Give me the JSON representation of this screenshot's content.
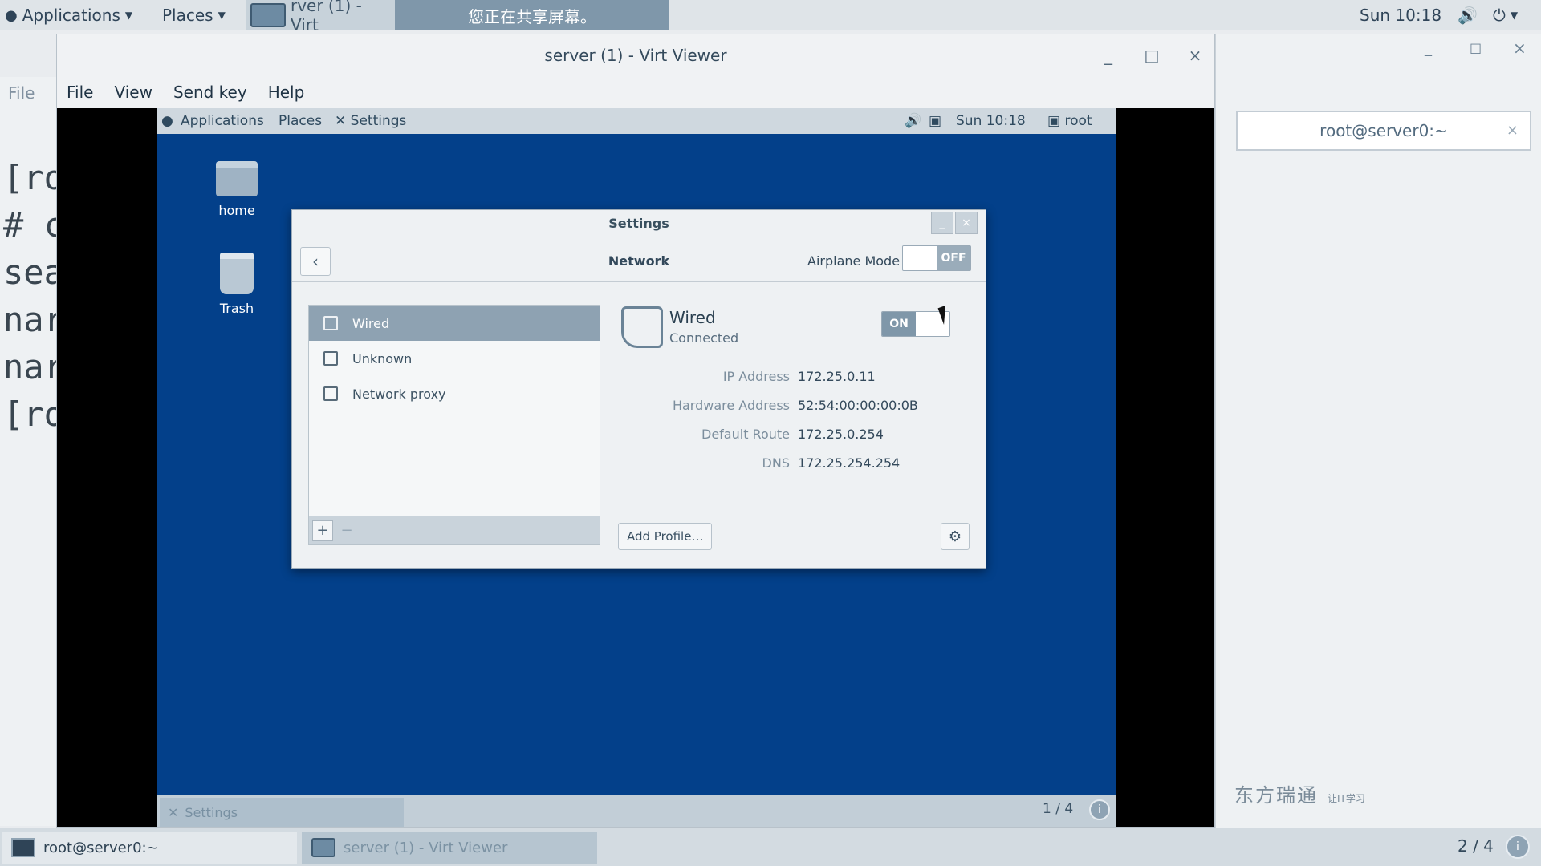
{
  "host_panel": {
    "applications": "Applications",
    "places": "Places",
    "task_title": "rver (1) - Virt",
    "share_notice": "您正在共享屏幕。",
    "clock": "Sun 10:18",
    "workspace": "2 / 4",
    "info": "i"
  },
  "bg_terminal": {
    "file_menu": "File",
    "lines": [
      "[ro",
      "# c",
      "sea",
      "nar",
      "nar",
      "[ro"
    ]
  },
  "right_window": {
    "tab_title": "root@server0:~",
    "close": "×",
    "minimize": "_",
    "maximize": "□",
    "close_btn": "×",
    "watermark": "东方瑞通",
    "watermark_small": "让IT学习"
  },
  "virt_viewer": {
    "title": "server (1) - Virt Viewer",
    "minimize": "_",
    "maximize": "□",
    "close": "×",
    "menu": [
      "File",
      "View",
      "Send key",
      "Help"
    ]
  },
  "guest": {
    "panel": {
      "applications": "Applications",
      "places": "Places",
      "settings": "Settings",
      "clock": "Sun 10:18",
      "user": "root"
    },
    "desktop_icons": {
      "home": "home",
      "trash": "Trash"
    },
    "taskbar": {
      "settings": "Settings",
      "workspace": "1 / 4",
      "info": "i"
    }
  },
  "settings_dialog": {
    "title": "Settings",
    "header_title": "Network",
    "back": "‹",
    "airplane_mode_label": "Airplane Mode",
    "airplane_state": "OFF",
    "connections": [
      "Wired",
      "Unknown",
      "Network proxy"
    ],
    "add": "+",
    "remove": "−",
    "wired": {
      "name": "Wired",
      "status": "Connected",
      "toggle_state": "ON",
      "details": [
        {
          "key": "IP Address",
          "value": "172.25.0.11"
        },
        {
          "key": "Hardware Address",
          "value": "52:54:00:00:00:0B"
        },
        {
          "key": "Default Route",
          "value": "172.25.0.254"
        },
        {
          "key": "DNS",
          "value": "172.25.254.254"
        }
      ]
    },
    "add_profile": "Add Profile…",
    "gear": "⚙"
  },
  "host_taskbar": {
    "terminal": "root@server0:~",
    "virt_viewer": "server (1) - Virt Viewer"
  }
}
